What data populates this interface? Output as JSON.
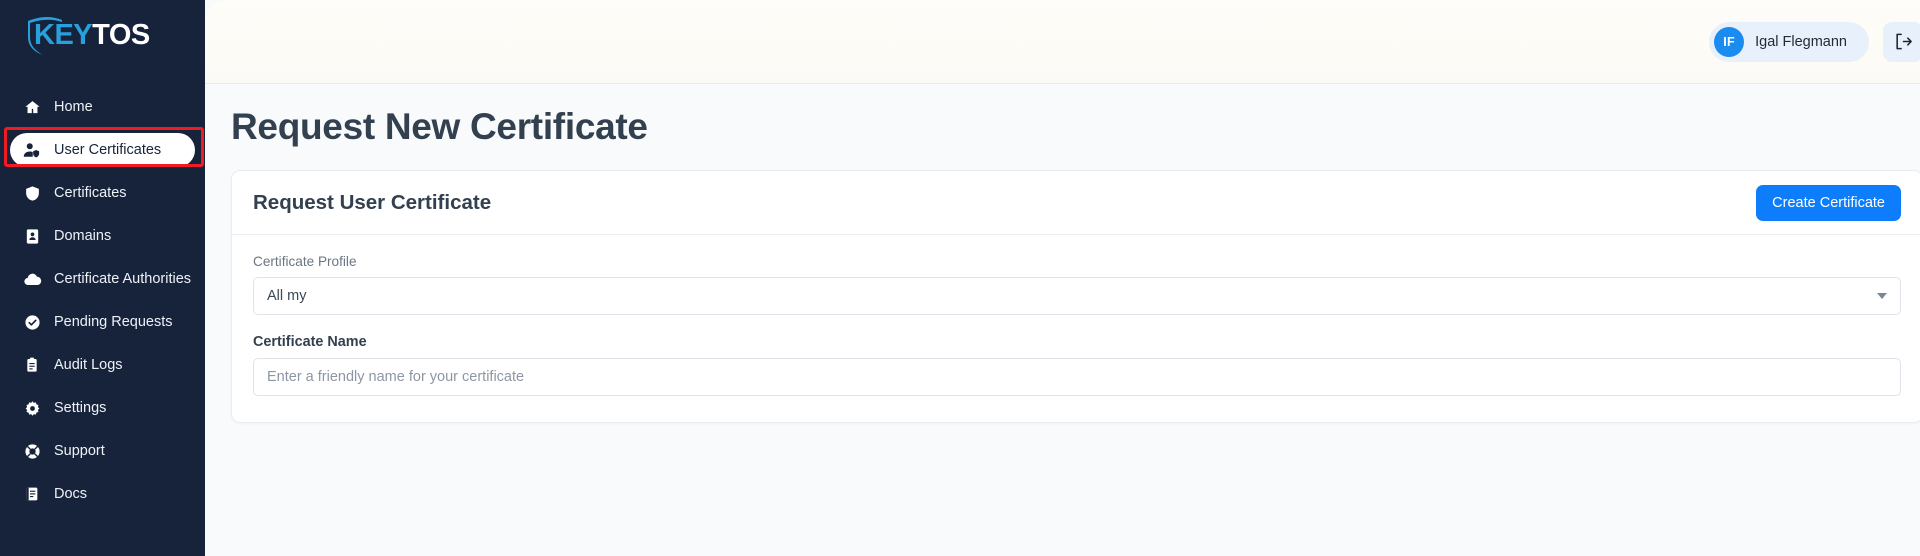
{
  "brand": {
    "logo_key": "KEY",
    "logo_tos": "TOS",
    "accent_blue": "#29a0de",
    "sidebar_bg": "#16233b"
  },
  "sidebar": {
    "items": [
      {
        "label": "Home",
        "icon": "home-icon",
        "active": false
      },
      {
        "label": "User Certificates",
        "icon": "user-certificate-icon",
        "active": true
      },
      {
        "label": "Certificates",
        "icon": "shield-icon",
        "active": false
      },
      {
        "label": "Domains",
        "icon": "address-book-icon",
        "active": false
      },
      {
        "label": "Certificate Authorities",
        "icon": "cloud-icon",
        "active": false
      },
      {
        "label": "Pending Requests",
        "icon": "check-circle-icon",
        "active": false
      },
      {
        "label": "Audit Logs",
        "icon": "clipboard-icon",
        "active": false
      },
      {
        "label": "Settings",
        "icon": "gear-icon",
        "active": false
      },
      {
        "label": "Support",
        "icon": "lifebuoy-icon",
        "active": false
      },
      {
        "label": "Docs",
        "icon": "book-icon",
        "active": false
      }
    ],
    "highlight_target": "User Certificates",
    "highlight_color": "#f01b24"
  },
  "topbar": {
    "user_initials": "IF",
    "user_name": "Igal Flegmann",
    "avatar_color": "#1a8cf0",
    "logout_icon": "logout-icon"
  },
  "page": {
    "title": "Request New Certificate"
  },
  "card": {
    "title": "Request User Certificate",
    "primary_button": "Create Certificate",
    "primary_button_color": "#0d7dfb",
    "fields": [
      {
        "label": "Certificate Profile",
        "type": "select",
        "value": "All my",
        "icon": "chevron-down-icon"
      },
      {
        "label": "Certificate Name",
        "type": "text",
        "value": "",
        "placeholder": "Enter a friendly name for your certificate"
      }
    ]
  }
}
